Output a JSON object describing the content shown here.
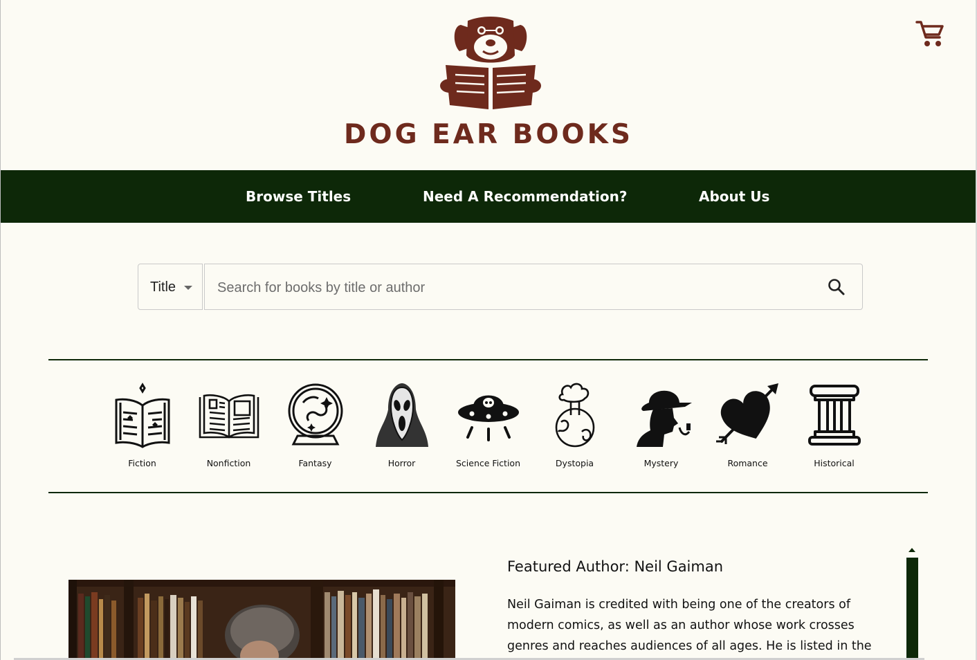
{
  "brand": {
    "name": "DOG EAR BOOKS",
    "color": "#6e2a1d"
  },
  "icons": {
    "logo": "dog-reading-book-logo",
    "cart": "shopping-cart-icon",
    "search": "search-icon"
  },
  "nav": {
    "background": "#0d2808",
    "items": [
      {
        "label": "Browse Titles"
      },
      {
        "label": "Need A Recommendation?"
      },
      {
        "label": "About Us"
      }
    ]
  },
  "search": {
    "filter_selected": "Title",
    "placeholder": "Search for books by title or author",
    "value": ""
  },
  "genres": [
    {
      "label": "Fiction",
      "icon": "open-book-sparkle-icon"
    },
    {
      "label": "Nonfiction",
      "icon": "open-book-text-icon"
    },
    {
      "label": "Fantasy",
      "icon": "crystal-ball-icon"
    },
    {
      "label": "Horror",
      "icon": "ghostface-mask-icon"
    },
    {
      "label": "Science Fiction",
      "icon": "ufo-icon"
    },
    {
      "label": "Dystopia",
      "icon": "nuclear-earth-icon"
    },
    {
      "label": "Mystery",
      "icon": "detective-icon"
    },
    {
      "label": "Romance",
      "icon": "heart-arrow-icon"
    },
    {
      "label": "Historical",
      "icon": "greek-column-icon"
    }
  ],
  "featured": {
    "title": "Featured Author: Neil Gaiman",
    "body": "Neil Gaiman is credited with being one of the creators of modern comics, as well as an author whose work crosses genres and reaches audiences of all ages. He is listed in the",
    "photo": "neil-gaiman-bookshelf-photo"
  }
}
